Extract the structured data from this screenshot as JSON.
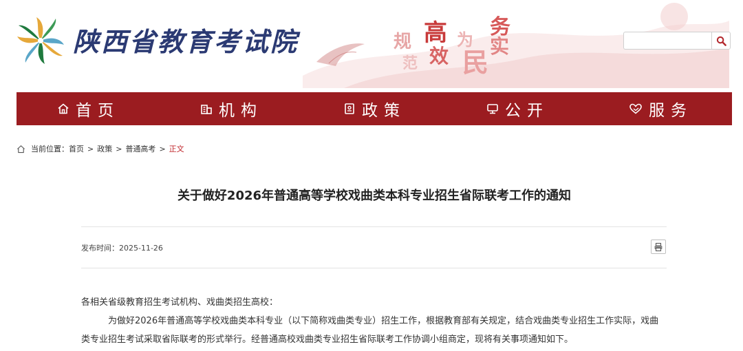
{
  "header": {
    "site_name": "陕西省教育考试院",
    "slogan": [
      "规",
      "范",
      "高",
      "效",
      "为",
      "民",
      "务",
      "实"
    ],
    "search": {
      "placeholder": "",
      "value": ""
    }
  },
  "nav": {
    "items": [
      {
        "label": "首页",
        "icon": "home-icon"
      },
      {
        "label": "机构",
        "icon": "building-icon"
      },
      {
        "label": "政策",
        "icon": "document-icon"
      },
      {
        "label": "公开",
        "icon": "monitor-icon"
      },
      {
        "label": "服务",
        "icon": "heart-hand-icon"
      }
    ]
  },
  "breadcrumb": {
    "prefix": "当前位置：",
    "items": [
      "首页",
      "政策",
      "普通高考"
    ],
    "separator": ">",
    "current": "正文"
  },
  "article": {
    "title": "关于做好2026年普通高等学校戏曲类本科专业招生省际联考工作的通知",
    "publish_label": "发布时间：",
    "publish_date": "2025-11-26",
    "paragraphs": [
      "各相关省级教育招生考试机构、戏曲类招生高校：",
      "为做好2026年普通高等学校戏曲类本科专业（以下简称戏曲类专业）招生工作，根据教育部有关规定，结合戏曲类专业招生工作实际，戏曲类专业招生考试采取省际联考的形式举行。经普通高校戏曲类专业招生省际联考工作协调小组商定，现将有关事项通知如下。"
    ]
  },
  "colors": {
    "nav_bg": "#9b1c20",
    "brand_text": "#2b3a73",
    "current_crumb": "#c0262b"
  }
}
